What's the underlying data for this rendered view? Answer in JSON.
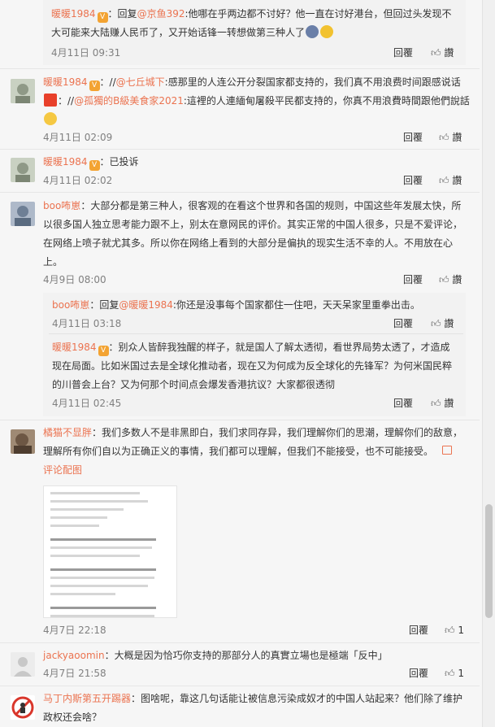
{
  "comments": [
    {
      "user": "暖暖1984",
      "reply_prefix": "：回复",
      "reply_to": "@京鱼392",
      "text_1": ":他哪在乎两边都不讨好？他一直在讨好港台，但回过头发现不",
      "text_2": "大可能来大陆赚人民币了，又开始话锋一转想做第三种人了",
      "time": "4月11日 09:31",
      "reply_label": "回覆",
      "like_label": "讚"
    },
    {
      "user": "暖暖1984",
      "prefix": "：//",
      "mention_1": "@七丘城下",
      "text_1": ":感那里的人连公开分裂国家都支持的，我们真不用浪费时间跟感说话",
      "mention_2": "@孤獨的B級美食家2021",
      "text_2": ":這裡的人連緬甸屠殺平民都支持的，你真不用浪費時間跟他們說話",
      "time": "4月11日 02:09",
      "reply_label": "回覆",
      "like_label": "讚"
    },
    {
      "user": "暖暖1984",
      "text_1": "：已投诉",
      "time": "4月11日 02:02",
      "reply_label": "回覆",
      "like_label": "讚"
    },
    {
      "user": "boo咘崽",
      "text_1": "：大部分都是第三种人，很客观的在看这个世界和各国的规则，中国这些年发展太快，所",
      "text_2": "以很多国人独立思考能力跟不上，别太在意网民的评价。其实正常的中国人很多，只是不爱评论，",
      "text_3": "在网络上喷子就尤其多。所以你在网络上看到的大部分是偏执的现实生活不幸的人。不用放在心",
      "text_4": "上。",
      "time": "4月9日 08:00",
      "reply_label": "回覆",
      "like_label": "讚",
      "sub_replies": [
        {
          "user": "boo咘崽",
          "reply_prefix": "：回复",
          "reply_to": "@暖暖1984",
          "text_1": ":你还是没事每个国家都住一住吧，天天呆家里重拳出击。",
          "time": "4月11日 03:18",
          "reply_label": "回覆",
          "like_label": "讚"
        },
        {
          "user": "暖暖1984",
          "text_1": "：别众人皆醉我独醒的样子，就是国人了解太透彻，看世界局势太透了，才造成",
          "text_2": "现在局面。比如米国过去是全球化推动者，现在又为何成为反全球化的先锋军？为何米国民粹",
          "text_3": "的川普会上台？又为何那个时间点会爆发香港抗议？大家都很透彻",
          "time": "4月11日 02:45",
          "reply_label": "回覆",
          "like_label": "讚"
        }
      ]
    },
    {
      "user": "橘猫不显胖",
      "text_1": "：我们多数人不是非黑即白，我们求同存异，我们理解你们的思潮，理解你们的敌意，",
      "text_2": "理解所有你们自以为正确正义的事情，我们都可以理解，但我们不能接受，也不可能接受。",
      "pic_link": "评论配图",
      "time": "4月7日 22:18",
      "reply_label": "回覆",
      "like_label": "1"
    },
    {
      "user": "jackyaoomin",
      "text_1": "：大概是因为恰巧你支持的那部分人的真實立場也是極端「反中」",
      "time": "4月7日 21:58",
      "reply_label": "回覆",
      "like_label": "1"
    },
    {
      "user": "马丁内斯第五开踢器",
      "text_1": "：图啥呢，靠这几句话能让被信息污染成奴才的中国人站起来？他们除了维护",
      "text_2": "政权还会啥？"
    }
  ],
  "colors": {
    "username": "#eb7350",
    "meta": "#808080",
    "background": "#f6f6f6"
  },
  "icons": {
    "like": "thumb-up-icon",
    "badge": "vip-badge-icon",
    "image": "image-icon"
  }
}
